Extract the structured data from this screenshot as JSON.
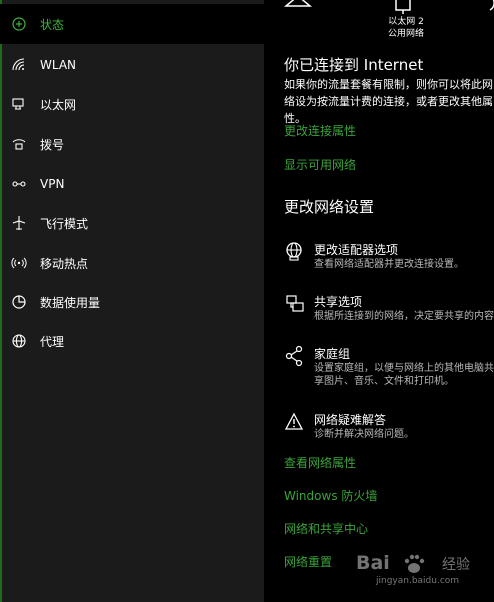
{
  "sidebar": {
    "items": [
      {
        "label": "状态",
        "icon": "status-icon",
        "active": true
      },
      {
        "label": "WLAN",
        "icon": "wifi-icon"
      },
      {
        "label": "以太网",
        "icon": "ethernet-icon"
      },
      {
        "label": "拨号",
        "icon": "dialup-icon"
      },
      {
        "label": "VPN",
        "icon": "vpn-icon"
      },
      {
        "label": "飞行模式",
        "icon": "airplane-icon"
      },
      {
        "label": "移动热点",
        "icon": "hotspot-icon"
      },
      {
        "label": "数据使用量",
        "icon": "data-usage-icon"
      },
      {
        "label": "代理",
        "icon": "globe-icon"
      }
    ]
  },
  "status": {
    "adapter_name": "以太网 2",
    "network_type": "公用网络",
    "connected_heading": "你已连接到 Internet",
    "connected_desc": "如果你的流量套餐有限制，则你可以将此网络设为按流量计费的连接，或者更改其他属性。",
    "change_props_link": "更改连接属性",
    "show_networks_link": "显示可用网络"
  },
  "change_settings": {
    "heading": "更改网络设置",
    "items": [
      {
        "title": "更改适配器选项",
        "desc": "查看网络适配器并更改连接设置。",
        "icon": "adapter-globe-icon"
      },
      {
        "title": "共享选项",
        "desc": "根据所连接到的网络，决定要共享的内容。",
        "icon": "sharing-icon"
      },
      {
        "title": "家庭组",
        "desc": "设置家庭组，以便与网络上的其他电脑共享图片、音乐、文件和打印机。",
        "icon": "homegroup-icon"
      },
      {
        "title": "网络疑难解答",
        "desc": "诊断并解决网络问题。",
        "icon": "warning-icon"
      }
    ]
  },
  "links": {
    "view_properties": "查看网络属性",
    "firewall": "Windows 防火墙",
    "sharing_center": "网络和共享中心",
    "reset": "网络重置"
  },
  "watermark": {
    "brand": "Bai",
    "brand_suffix": "经验",
    "sub": "jingyan.baidu.com"
  },
  "colors": {
    "accent": "#3cb53c",
    "link": "#3aa33a",
    "sidebar_bg": "#1b1b1b",
    "main_bg": "#000000"
  }
}
